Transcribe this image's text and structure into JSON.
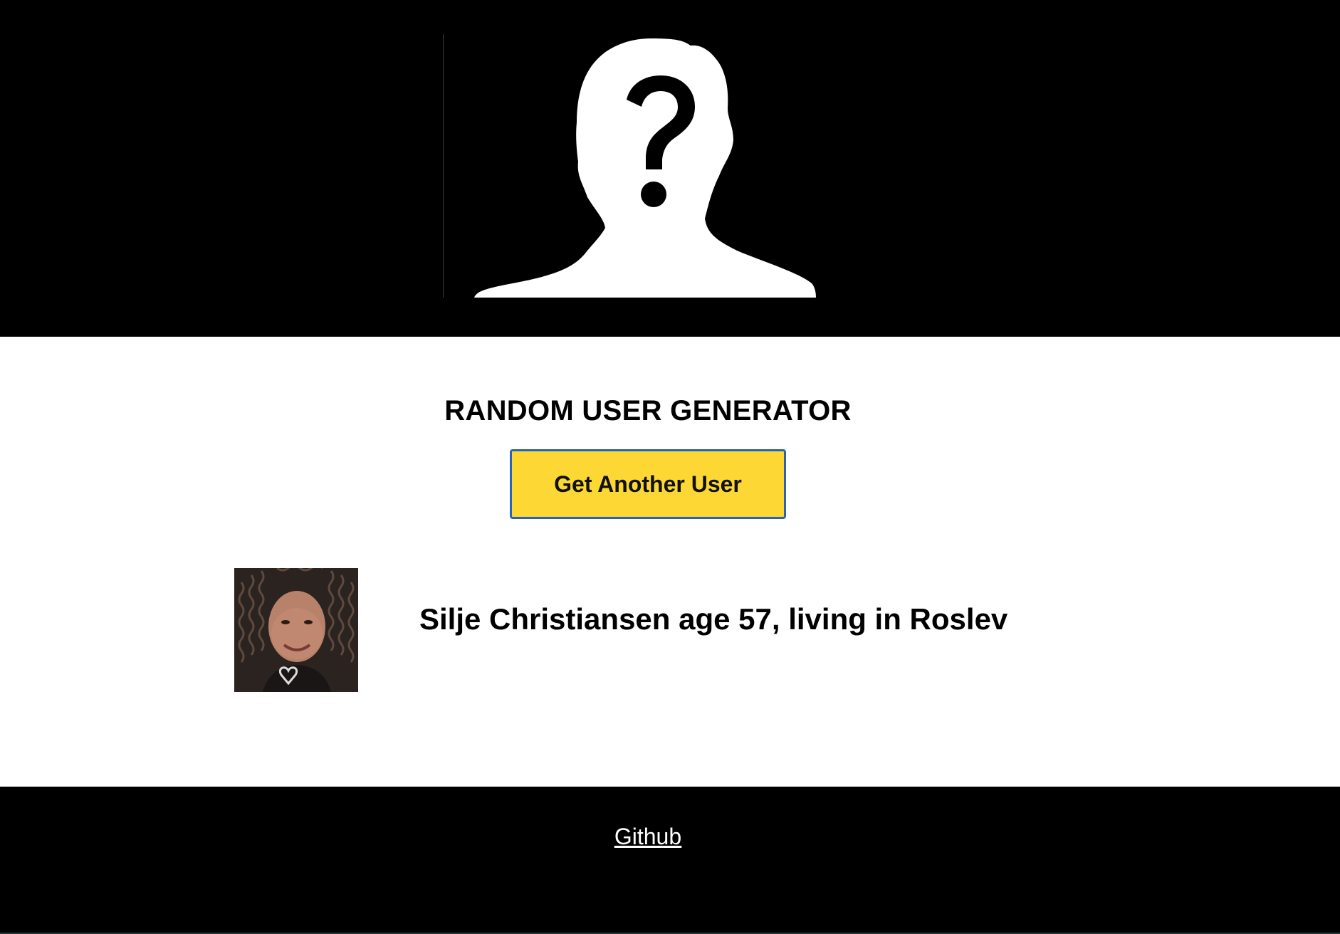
{
  "header": {
    "hero_icon": "unknown-person-question-icon"
  },
  "main": {
    "title": "RANDOM USER GENERATOR",
    "get_user_button_label": "Get Another User",
    "user": {
      "avatar": "user-photo",
      "info": "Silje Christiansen age 57, living in Roslev"
    }
  },
  "footer": {
    "github_label": "Github"
  },
  "colors": {
    "header_bg": "#000000",
    "button_bg": "#fdd835",
    "button_border": "#2a62b8",
    "footer_bg": "#000000",
    "text": "#000000"
  }
}
